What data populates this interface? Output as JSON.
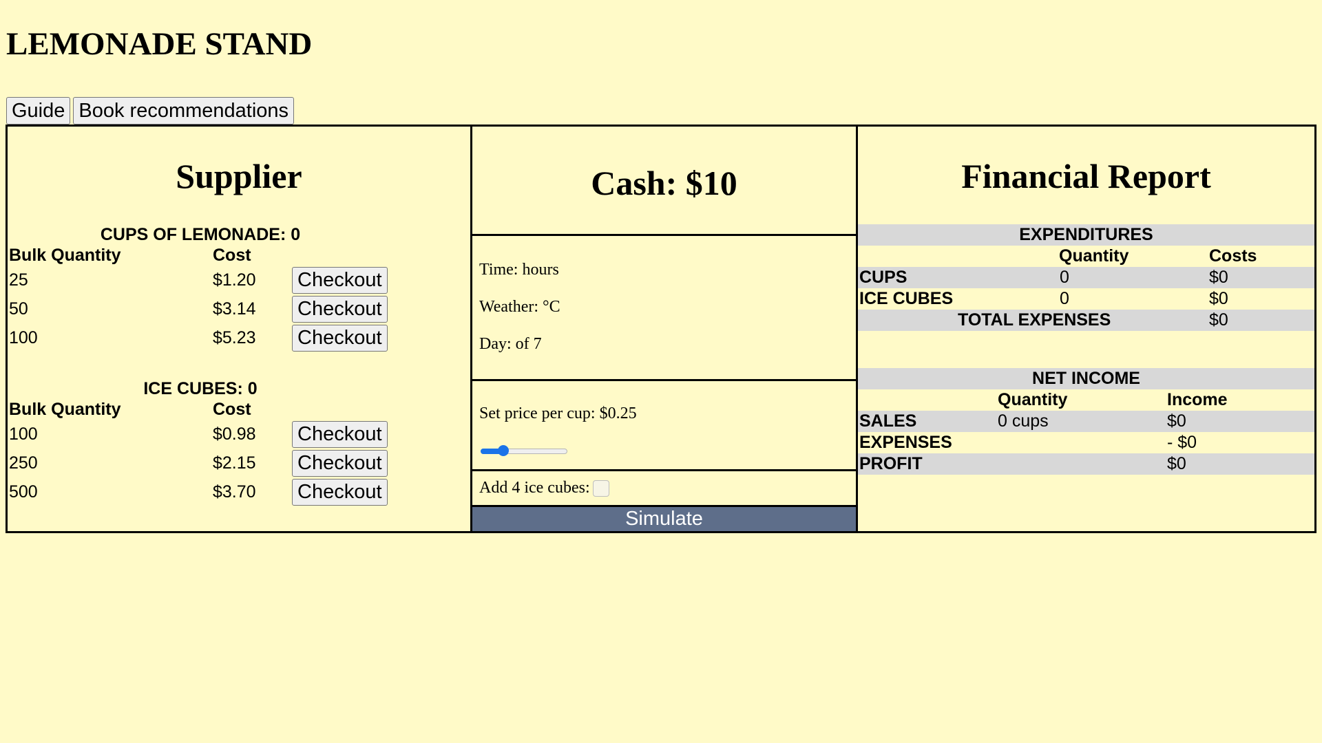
{
  "app": {
    "title": "LEMONADE STAND"
  },
  "nav": {
    "guide": "Guide",
    "books": "Book recommendations"
  },
  "supplier": {
    "title": "Supplier",
    "cups": {
      "heading": "CUPS OF LEMONADE: 0",
      "col_qty": "Bulk Quantity",
      "col_cost": "Cost",
      "rows": [
        {
          "qty": "25",
          "cost": "$1.20",
          "btn": "Checkout"
        },
        {
          "qty": "50",
          "cost": "$3.14",
          "btn": "Checkout"
        },
        {
          "qty": "100",
          "cost": "$5.23",
          "btn": "Checkout"
        }
      ]
    },
    "ice": {
      "heading": "ICE CUBES: 0",
      "col_qty": "Bulk Quantity",
      "col_cost": "Cost",
      "rows": [
        {
          "qty": "100",
          "cost": "$0.98",
          "btn": "Checkout"
        },
        {
          "qty": "250",
          "cost": "$2.15",
          "btn": "Checkout"
        },
        {
          "qty": "500",
          "cost": "$3.70",
          "btn": "Checkout"
        }
      ]
    }
  },
  "middle": {
    "cash": "Cash: $10",
    "time": "Time: hours",
    "weather": "Weather: °C",
    "day": "Day: of 7",
    "price_label": "Set price per cup: $0.25",
    "price_fraction": 0.26,
    "slider_accent": "#1a73e8",
    "ice_label": "Add 4 ice cubes:",
    "ice_checked": false,
    "simulate": "Simulate",
    "simulate_color": "#5e6e8a"
  },
  "report": {
    "title": "Financial Report",
    "expenditures": {
      "heading": "EXPENDITURES",
      "col_qty": "Quantity",
      "col_cost": "Costs",
      "rows": [
        {
          "label": "CUPS",
          "qty": "0",
          "cost": "$0"
        },
        {
          "label": "ICE CUBES",
          "qty": "0",
          "cost": "$0"
        }
      ],
      "total_label": "TOTAL EXPENSES",
      "total_value": "$0"
    },
    "net_income": {
      "heading": "NET INCOME",
      "col_qty": "Quantity",
      "col_income": "Income",
      "sales_label": "SALES",
      "sales_qty": "0 cups",
      "sales_income": "$0",
      "expenses_label": "EXPENSES",
      "expenses_value": "- $0",
      "profit_label": "PROFIT",
      "profit_value": "$0"
    }
  },
  "colors": {
    "background": "#fffac8",
    "row_shade": "#d8d8d8"
  }
}
